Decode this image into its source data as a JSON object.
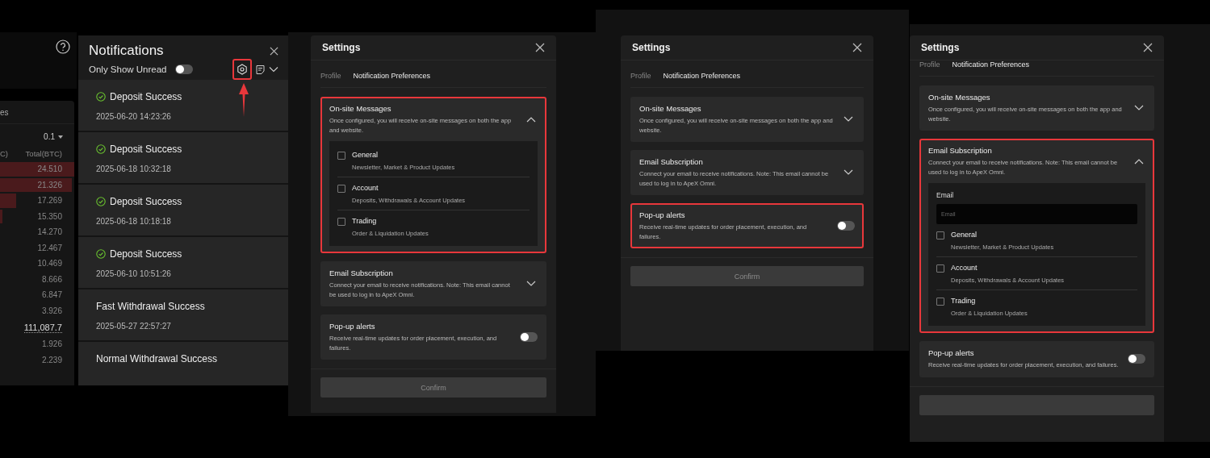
{
  "order_book": {
    "header": "es",
    "step": "0.1",
    "columns": [
      "C)",
      "Total(BTC)"
    ],
    "rows": [
      {
        "total": "24.510"
      },
      {
        "total": "21.326"
      },
      {
        "total": "17.269"
      },
      {
        "total": "15.350"
      },
      {
        "total": "14.270"
      },
      {
        "total": "12.467"
      },
      {
        "total": "10.469"
      },
      {
        "total": "8.666"
      },
      {
        "total": "6.847"
      },
      {
        "total": "3.926"
      }
    ],
    "mid_price": "111,087.7",
    "lower_rows": [
      {
        "total": "1.926"
      },
      {
        "total": "2.239"
      }
    ]
  },
  "notifications": {
    "title": "Notifications",
    "filter_label": "Only Show Unread",
    "filter_on": false,
    "settings_highlighted": true,
    "items": [
      {
        "kind": "success",
        "title": "Deposit Success",
        "time": "2025-06-20 14:23:26"
      },
      {
        "kind": "success",
        "title": "Deposit Success",
        "time": "2025-06-18 10:32:18"
      },
      {
        "kind": "success",
        "title": "Deposit Success",
        "time": "2025-06-18 10:18:18"
      },
      {
        "kind": "success",
        "title": "Deposit Success",
        "time": "2025-06-10 10:51:26"
      },
      {
        "kind": "plain",
        "title": "Fast Withdrawal Success",
        "time": "2025-05-27 22:57:27"
      },
      {
        "kind": "plain",
        "title": "Normal Withdrawal Success"
      }
    ]
  },
  "settings_panels": [
    {
      "title": "Settings",
      "tabs": [
        {
          "label": "Profile",
          "selected": false
        },
        {
          "label": "Notification Preferences",
          "selected": true
        }
      ],
      "sections": [
        {
          "kind": "collapsible",
          "title": "On-site Messages",
          "description": "Once configured, you will receive on-site messages on both the app and website.",
          "expanded": true,
          "highlighted": true,
          "options": [
            {
              "label": "General",
              "description": "Newsletter, Market & Product Updates",
              "checked": false
            },
            {
              "label": "Account",
              "description": "Deposits, Withdrawals & Account Updates",
              "checked": false
            },
            {
              "label": "Trading",
              "description": "Order & Liquidation Updates",
              "checked": false
            }
          ]
        },
        {
          "kind": "collapsible",
          "title": "Email Subscription",
          "description": "Connect your email to receive notifications. Note: This email cannot be used to log in to ApeX Omni.",
          "expanded": false,
          "highlighted": false
        },
        {
          "kind": "toggle",
          "title": "Pop-up alerts",
          "description": "Receive real-time updates for order placement, execution, and failures.",
          "on": false,
          "highlighted": false
        }
      ],
      "confirm": {
        "label": "Confirm",
        "disabled": true
      }
    },
    {
      "title": "Settings",
      "tabs": [
        {
          "label": "Profile",
          "selected": false
        },
        {
          "label": "Notification Preferences",
          "selected": true
        }
      ],
      "sections": [
        {
          "kind": "collapsible",
          "title": "On-site Messages",
          "description": "Once configured, you will receive on-site messages on both the app and website.",
          "expanded": false,
          "highlighted": false
        },
        {
          "kind": "collapsible",
          "title": "Email Subscription",
          "description": "Connect your email to receive notifications. Note: This email cannot be used to log in to ApeX Omni.",
          "expanded": false,
          "highlighted": false
        },
        {
          "kind": "toggle",
          "title": "Pop-up alerts",
          "description": "Receive real-time updates for order placement, execution, and failures.",
          "on": false,
          "highlighted": true
        }
      ],
      "confirm": {
        "label": "Confirm",
        "disabled": true
      }
    },
    {
      "title": "Settings",
      "tabs": [
        {
          "label": "Profile",
          "selected": false
        },
        {
          "label": "Notification Preferences",
          "selected": true
        }
      ],
      "sections": [
        {
          "kind": "collapsible",
          "title": "On-site Messages",
          "description": "Once configured, you will receive on-site messages on both the app and website.",
          "expanded": false,
          "highlighted": false
        },
        {
          "kind": "collapsible",
          "title": "Email Subscription",
          "description": "Connect your email to receive notifications. Note: This email cannot be used to log in to ApeX Omni.",
          "expanded": true,
          "highlighted": true,
          "field": {
            "label": "Email",
            "placeholder": "Email"
          },
          "options": [
            {
              "label": "General",
              "description": "Newsletter, Market & Product Updates",
              "checked": false
            },
            {
              "label": "Account",
              "description": "Deposits, Withdrawals & Account Updates",
              "checked": false
            },
            {
              "label": "Trading",
              "description": "Order & Liquidation Updates",
              "checked": false
            }
          ]
        },
        {
          "kind": "toggle",
          "title": "Pop-up alerts",
          "description": "Receive real-time updates for order placement, execution, and failures.",
          "on": false,
          "highlighted": false
        }
      ],
      "confirm": {
        "disabled": true
      }
    }
  ]
}
